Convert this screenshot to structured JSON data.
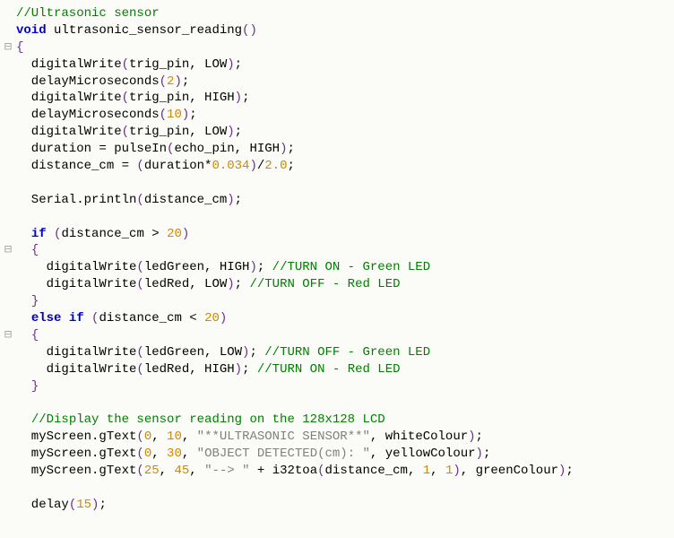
{
  "code": {
    "lines": [
      {
        "gutter": " ",
        "tokens": [
          {
            "cls": "tok-comment",
            "t": "//Ultrasonic sensor"
          }
        ]
      },
      {
        "gutter": " ",
        "tokens": [
          {
            "cls": "tok-keyword",
            "t": "void"
          },
          {
            "cls": "tok-plain",
            "t": " ultrasonic_sensor_reading"
          },
          {
            "cls": "tok-paren",
            "t": "()"
          }
        ]
      },
      {
        "gutter": "⊟",
        "tokens": [
          {
            "cls": "tok-brace",
            "t": "{"
          }
        ]
      },
      {
        "gutter": " ",
        "tokens": [
          {
            "cls": "tok-plain",
            "t": "  digitalWrite"
          },
          {
            "cls": "tok-paren",
            "t": "("
          },
          {
            "cls": "tok-plain",
            "t": "trig_pin, LOW"
          },
          {
            "cls": "tok-paren",
            "t": ")"
          },
          {
            "cls": "tok-plain",
            "t": ";"
          }
        ]
      },
      {
        "gutter": " ",
        "tokens": [
          {
            "cls": "tok-plain",
            "t": "  delayMicroseconds"
          },
          {
            "cls": "tok-paren",
            "t": "("
          },
          {
            "cls": "tok-num",
            "t": "2"
          },
          {
            "cls": "tok-paren",
            "t": ")"
          },
          {
            "cls": "tok-plain",
            "t": ";"
          }
        ]
      },
      {
        "gutter": " ",
        "tokens": [
          {
            "cls": "tok-plain",
            "t": "  digitalWrite"
          },
          {
            "cls": "tok-paren",
            "t": "("
          },
          {
            "cls": "tok-plain",
            "t": "trig_pin, HIGH"
          },
          {
            "cls": "tok-paren",
            "t": ")"
          },
          {
            "cls": "tok-plain",
            "t": ";"
          }
        ]
      },
      {
        "gutter": " ",
        "tokens": [
          {
            "cls": "tok-plain",
            "t": "  delayMicroseconds"
          },
          {
            "cls": "tok-paren",
            "t": "("
          },
          {
            "cls": "tok-num",
            "t": "10"
          },
          {
            "cls": "tok-paren",
            "t": ")"
          },
          {
            "cls": "tok-plain",
            "t": ";"
          }
        ]
      },
      {
        "gutter": " ",
        "tokens": [
          {
            "cls": "tok-plain",
            "t": "  digitalWrite"
          },
          {
            "cls": "tok-paren",
            "t": "("
          },
          {
            "cls": "tok-plain",
            "t": "trig_pin, LOW"
          },
          {
            "cls": "tok-paren",
            "t": ")"
          },
          {
            "cls": "tok-plain",
            "t": ";"
          }
        ]
      },
      {
        "gutter": " ",
        "tokens": [
          {
            "cls": "tok-plain",
            "t": "  duration = pulseIn"
          },
          {
            "cls": "tok-paren",
            "t": "("
          },
          {
            "cls": "tok-plain",
            "t": "echo_pin, HIGH"
          },
          {
            "cls": "tok-paren",
            "t": ")"
          },
          {
            "cls": "tok-plain",
            "t": ";"
          }
        ]
      },
      {
        "gutter": " ",
        "tokens": [
          {
            "cls": "tok-plain",
            "t": "  distance_cm = "
          },
          {
            "cls": "tok-paren",
            "t": "("
          },
          {
            "cls": "tok-plain",
            "t": "duration*"
          },
          {
            "cls": "tok-num",
            "t": "0.034"
          },
          {
            "cls": "tok-paren",
            "t": ")"
          },
          {
            "cls": "tok-plain",
            "t": "/"
          },
          {
            "cls": "tok-num",
            "t": "2.0"
          },
          {
            "cls": "tok-plain",
            "t": ";"
          }
        ]
      },
      {
        "gutter": " ",
        "tokens": [
          {
            "cls": "tok-plain",
            "t": ""
          }
        ]
      },
      {
        "gutter": " ",
        "tokens": [
          {
            "cls": "tok-plain",
            "t": "  Serial.println"
          },
          {
            "cls": "tok-paren",
            "t": "("
          },
          {
            "cls": "tok-plain",
            "t": "distance_cm"
          },
          {
            "cls": "tok-paren",
            "t": ")"
          },
          {
            "cls": "tok-plain",
            "t": ";"
          }
        ]
      },
      {
        "gutter": " ",
        "tokens": [
          {
            "cls": "tok-plain",
            "t": ""
          }
        ]
      },
      {
        "gutter": " ",
        "tokens": [
          {
            "cls": "tok-plain",
            "t": "  "
          },
          {
            "cls": "tok-keyword",
            "t": "if"
          },
          {
            "cls": "tok-plain",
            "t": " "
          },
          {
            "cls": "tok-paren",
            "t": "("
          },
          {
            "cls": "tok-plain",
            "t": "distance_cm > "
          },
          {
            "cls": "tok-num",
            "t": "20"
          },
          {
            "cls": "tok-paren",
            "t": ")"
          }
        ]
      },
      {
        "gutter": "⊟",
        "tokens": [
          {
            "cls": "tok-plain",
            "t": "  "
          },
          {
            "cls": "tok-brace",
            "t": "{"
          }
        ]
      },
      {
        "gutter": " ",
        "tokens": [
          {
            "cls": "tok-plain",
            "t": "    digitalWrite"
          },
          {
            "cls": "tok-paren",
            "t": "("
          },
          {
            "cls": "tok-plain",
            "t": "ledGreen, HIGH"
          },
          {
            "cls": "tok-paren",
            "t": ")"
          },
          {
            "cls": "tok-plain",
            "t": "; "
          },
          {
            "cls": "tok-comment",
            "t": "//TURN ON - Green LED"
          }
        ]
      },
      {
        "gutter": " ",
        "tokens": [
          {
            "cls": "tok-plain",
            "t": "    digitalWrite"
          },
          {
            "cls": "tok-paren",
            "t": "("
          },
          {
            "cls": "tok-plain",
            "t": "ledRed, LOW"
          },
          {
            "cls": "tok-paren",
            "t": ")"
          },
          {
            "cls": "tok-plain",
            "t": "; "
          },
          {
            "cls": "tok-comment",
            "t": "//TURN OFF - Red LED"
          }
        ]
      },
      {
        "gutter": " ",
        "tokens": [
          {
            "cls": "tok-plain",
            "t": "  "
          },
          {
            "cls": "tok-brace",
            "t": "}"
          }
        ]
      },
      {
        "gutter": " ",
        "tokens": [
          {
            "cls": "tok-plain",
            "t": "  "
          },
          {
            "cls": "tok-keyword",
            "t": "else"
          },
          {
            "cls": "tok-plain",
            "t": " "
          },
          {
            "cls": "tok-keyword",
            "t": "if"
          },
          {
            "cls": "tok-plain",
            "t": " "
          },
          {
            "cls": "tok-paren",
            "t": "("
          },
          {
            "cls": "tok-plain",
            "t": "distance_cm < "
          },
          {
            "cls": "tok-num",
            "t": "20"
          },
          {
            "cls": "tok-paren",
            "t": ")"
          }
        ]
      },
      {
        "gutter": "⊟",
        "tokens": [
          {
            "cls": "tok-plain",
            "t": "  "
          },
          {
            "cls": "tok-brace",
            "t": "{"
          }
        ]
      },
      {
        "gutter": " ",
        "tokens": [
          {
            "cls": "tok-plain",
            "t": "    digitalWrite"
          },
          {
            "cls": "tok-paren",
            "t": "("
          },
          {
            "cls": "tok-plain",
            "t": "ledGreen, LOW"
          },
          {
            "cls": "tok-paren",
            "t": ")"
          },
          {
            "cls": "tok-plain",
            "t": "; "
          },
          {
            "cls": "tok-comment",
            "t": "//TURN OFF - Green LED"
          }
        ]
      },
      {
        "gutter": " ",
        "tokens": [
          {
            "cls": "tok-plain",
            "t": "    digitalWrite"
          },
          {
            "cls": "tok-paren",
            "t": "("
          },
          {
            "cls": "tok-plain",
            "t": "ledRed, HIGH"
          },
          {
            "cls": "tok-paren",
            "t": ")"
          },
          {
            "cls": "tok-plain",
            "t": "; "
          },
          {
            "cls": "tok-comment",
            "t": "//TURN ON - Red LED"
          }
        ]
      },
      {
        "gutter": " ",
        "tokens": [
          {
            "cls": "tok-plain",
            "t": "  "
          },
          {
            "cls": "tok-brace",
            "t": "}"
          }
        ]
      },
      {
        "gutter": " ",
        "tokens": [
          {
            "cls": "tok-plain",
            "t": ""
          }
        ]
      },
      {
        "gutter": " ",
        "tokens": [
          {
            "cls": "tok-plain",
            "t": "  "
          },
          {
            "cls": "tok-comment",
            "t": "//Display the sensor reading on the 128x128 LCD"
          }
        ]
      },
      {
        "gutter": " ",
        "tokens": [
          {
            "cls": "tok-plain",
            "t": "  myScreen.gText"
          },
          {
            "cls": "tok-paren",
            "t": "("
          },
          {
            "cls": "tok-num",
            "t": "0"
          },
          {
            "cls": "tok-plain",
            "t": ", "
          },
          {
            "cls": "tok-num",
            "t": "10"
          },
          {
            "cls": "tok-plain",
            "t": ", "
          },
          {
            "cls": "tok-string",
            "t": "\"**ULTRASONIC SENSOR**\""
          },
          {
            "cls": "tok-plain",
            "t": ", whiteColour"
          },
          {
            "cls": "tok-paren",
            "t": ")"
          },
          {
            "cls": "tok-plain",
            "t": ";"
          }
        ]
      },
      {
        "gutter": " ",
        "tokens": [
          {
            "cls": "tok-plain",
            "t": "  myScreen.gText"
          },
          {
            "cls": "tok-paren",
            "t": "("
          },
          {
            "cls": "tok-num",
            "t": "0"
          },
          {
            "cls": "tok-plain",
            "t": ", "
          },
          {
            "cls": "tok-num",
            "t": "30"
          },
          {
            "cls": "tok-plain",
            "t": ", "
          },
          {
            "cls": "tok-string",
            "t": "\"OBJECT DETECTED(cm): \""
          },
          {
            "cls": "tok-plain",
            "t": ", yellowColour"
          },
          {
            "cls": "tok-paren",
            "t": ")"
          },
          {
            "cls": "tok-plain",
            "t": ";"
          }
        ]
      },
      {
        "gutter": " ",
        "tokens": [
          {
            "cls": "tok-plain",
            "t": "  myScreen.gText"
          },
          {
            "cls": "tok-paren",
            "t": "("
          },
          {
            "cls": "tok-num",
            "t": "25"
          },
          {
            "cls": "tok-plain",
            "t": ", "
          },
          {
            "cls": "tok-num",
            "t": "45"
          },
          {
            "cls": "tok-plain",
            "t": ", "
          },
          {
            "cls": "tok-string",
            "t": "\"--> \""
          },
          {
            "cls": "tok-plain",
            "t": " + i32toa"
          },
          {
            "cls": "tok-paren",
            "t": "("
          },
          {
            "cls": "tok-plain",
            "t": "distance_cm, "
          },
          {
            "cls": "tok-num",
            "t": "1"
          },
          {
            "cls": "tok-plain",
            "t": ", "
          },
          {
            "cls": "tok-num",
            "t": "1"
          },
          {
            "cls": "tok-paren",
            "t": ")"
          },
          {
            "cls": "tok-plain",
            "t": ", greenColour"
          },
          {
            "cls": "tok-paren",
            "t": ")"
          },
          {
            "cls": "tok-plain",
            "t": ";"
          }
        ]
      },
      {
        "gutter": " ",
        "tokens": [
          {
            "cls": "tok-plain",
            "t": ""
          }
        ]
      },
      {
        "gutter": " ",
        "tokens": [
          {
            "cls": "tok-plain",
            "t": "  delay"
          },
          {
            "cls": "tok-paren",
            "t": "("
          },
          {
            "cls": "tok-num",
            "t": "15"
          },
          {
            "cls": "tok-paren",
            "t": ")"
          },
          {
            "cls": "tok-plain",
            "t": ";"
          }
        ]
      }
    ]
  }
}
